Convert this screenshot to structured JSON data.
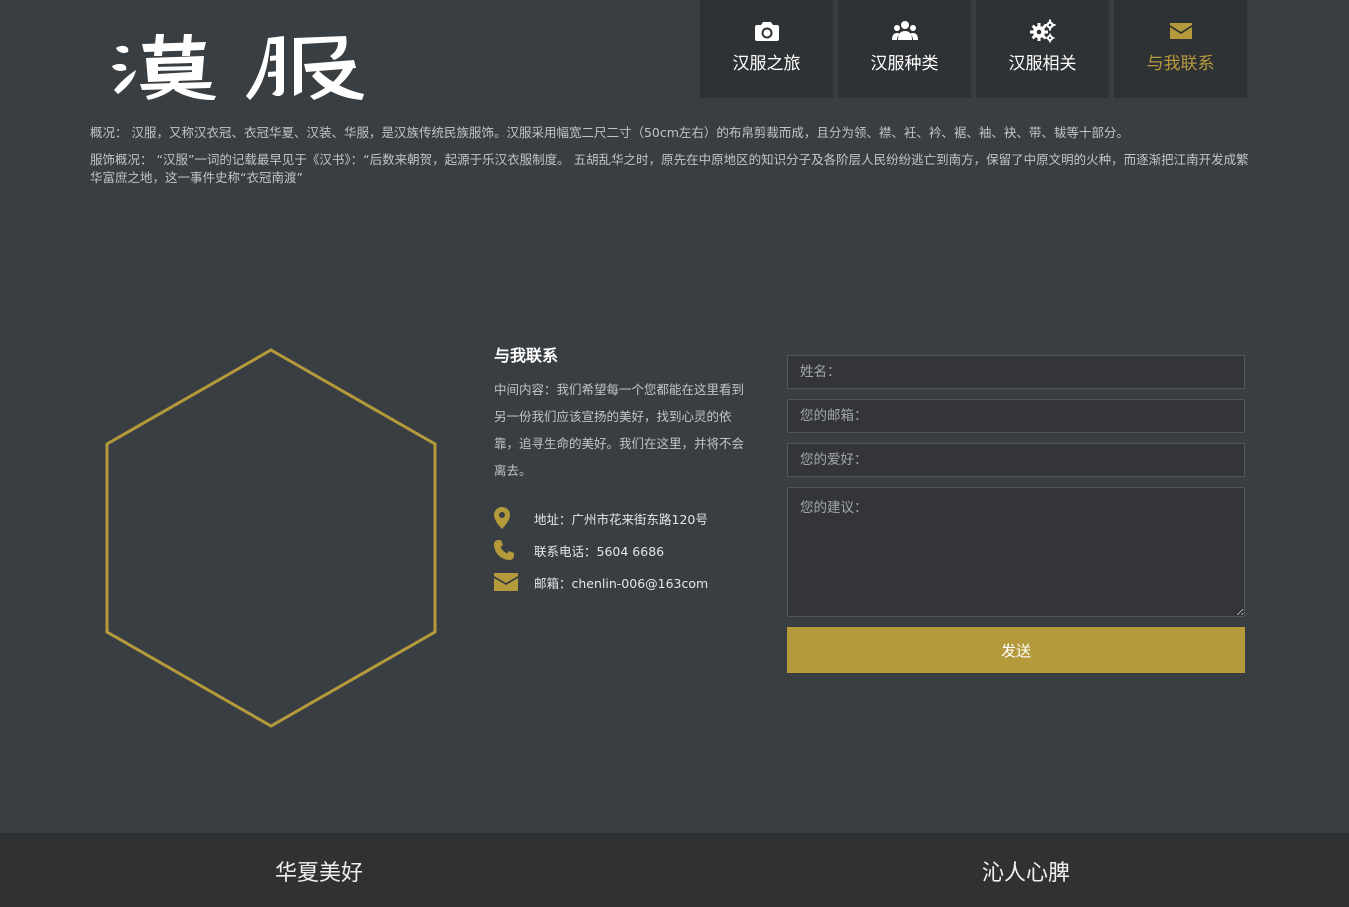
{
  "header": {
    "logo_text": "漢服",
    "nav": [
      {
        "label": "汉服之旅",
        "icon": "camera-icon"
      },
      {
        "label": "汉服种类",
        "icon": "users-icon"
      },
      {
        "label": "汉服相关",
        "icon": "gears-icon"
      },
      {
        "label": "与我联系",
        "icon": "envelope-icon",
        "active": true
      }
    ]
  },
  "intro": {
    "p1": "概况： 汉服，又称汉衣冠、衣冠华夏、汉装、华服，是汉族传统民族服饰。汉服采用幅宽二尺二寸（50cm左右）的布帛剪裁而成，且分为领、襟、衽、衿、裾、袖、袂、带、韨等十部分。",
    "p2": "服饰概况： “汉服”一词的记载最早见于《汉书》：“后数来朝贺，起源于乐汉衣服制度。 五胡乱华之时，原先在中原地区的知识分子及各阶层人民纷纷逃亡到南方，保留了中原文明的火种，而逐渐把江南开发成繁华富庶之地，这一事件史称“衣冠南渡”"
  },
  "contact": {
    "title": "与我联系",
    "desc": "中间内容：我们希望每一个您都能在这里看到另一份我们应该宣扬的美好，找到心灵的依靠，追寻生命的美好。我们在这里，并将不会离去。",
    "address": "地址：广州市花来街东路120号",
    "phone": "联系电话：5604 6686",
    "email": "邮箱：chenlin-006@163com"
  },
  "form": {
    "name_placeholder": "姓名：",
    "email_placeholder": "您的邮箱：",
    "hobby_placeholder": "您的爱好：",
    "suggestion_placeholder": "您的建议：",
    "send_label": "发送"
  },
  "footer": {
    "left": "华夏美好",
    "right": "沁人心脾"
  },
  "colors": {
    "accent": "#b59a3c",
    "background": "#393e42",
    "nav_bg": "#2f3235",
    "footer_bg": "#2f3132"
  }
}
